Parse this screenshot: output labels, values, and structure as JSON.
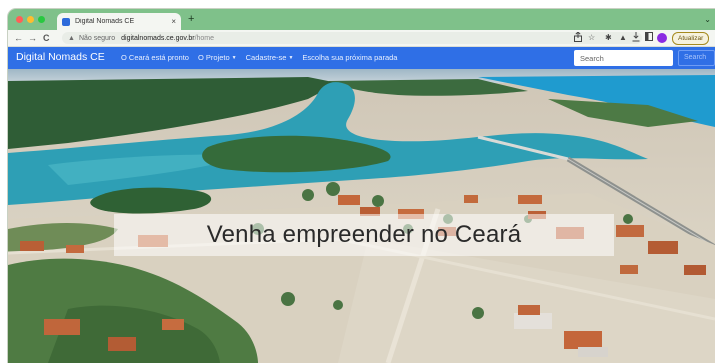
{
  "browser": {
    "tab_title": "Digital Nomads CE",
    "tab_close": "×",
    "new_tab": "+",
    "expand": "⌄",
    "nav_back": "←",
    "nav_forward": "→",
    "nav_reload": "C",
    "security_icon": "warning-triangle-icon",
    "security_label": "Não seguro",
    "url_host": "digitalnomads.ce.gov.br",
    "url_path": "/home",
    "update_label": "Atualizar"
  },
  "site": {
    "brand": "Digital Nomads CE",
    "nav": [
      {
        "label": "O Ceará está pronto",
        "dropdown": false
      },
      {
        "label": "O Projeto",
        "dropdown": true
      },
      {
        "label": "Cadastre-se",
        "dropdown": true
      },
      {
        "label": "Escolha sua próxima parada",
        "dropdown": false
      }
    ],
    "search_placeholder": "Search",
    "search_button": "Search"
  },
  "hero": {
    "title": "Venha empreender no Ceará",
    "image_subject": "aerial-photo-coastal-lagoon"
  },
  "colors": {
    "navbar": "#2f6fe6",
    "tabbar": "#7fc18a",
    "water": "#2e9fb5",
    "sea": "#1f9bcf"
  }
}
